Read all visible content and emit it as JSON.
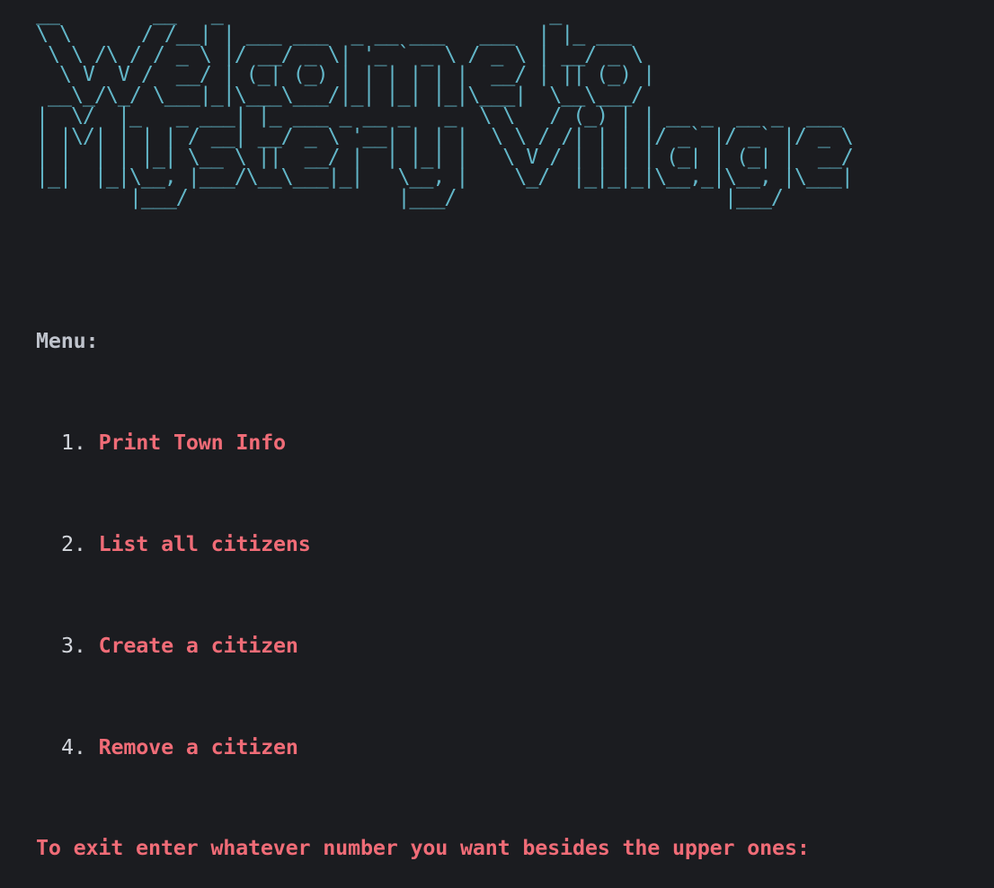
{
  "banner": {
    "art": "__        __   _                            _\n\\ \\      / /__| | ___ ___  _ __ ___   ___  | |_ ___\n \\ \\ /\\ / / _ \\ |/ __/ _ \\| '_ ` _ \\ / _ \\ | __/ _ \\\n  \\ V  V /  __/ | (_| (_) | | | | | |  __/ | || (_) |\n __\\_/\\_/ \\___|_|\\___\\___/|_| |_| |_|\\___|  \\__\\___/\n|  \\/  |_   _ ___| |_ ___ _ __ _   _  \\ \\   / (_) | | __ _  __ _  ___\n| |\\/| | | | / __| __/ _ \\ '__| | | |  \\ \\ / /| | | |/ _` |/ _` |/ _ \\\n| |  | | |_| \\__ \\ ||  __/ |  | |_| |   \\ V / | | | | (_| | (_| |  __/\n|_|  |_|\\__, |___/\\__\\___|_|   \\__, |    \\_/  |_|_|_|\\__,_|\\__, |\\___|\n        |___/                  |___/                       |___/",
    "color": "#62b6c8"
  },
  "menu": {
    "heading": "Menu:",
    "items": [
      {
        "number": "1.",
        "label": "Print Town Info"
      },
      {
        "number": "2.",
        "label": "List all citizens"
      },
      {
        "number": "3.",
        "label": "Create a citizen"
      },
      {
        "number": "4.",
        "label": "Remove a citizen"
      }
    ],
    "exit_prompt": "To exit enter whatever number you want besides the upper ones:"
  },
  "colors": {
    "background": "#1b1c20",
    "menu_text": "#f06c77",
    "heading_text": "#bfc3cc"
  }
}
